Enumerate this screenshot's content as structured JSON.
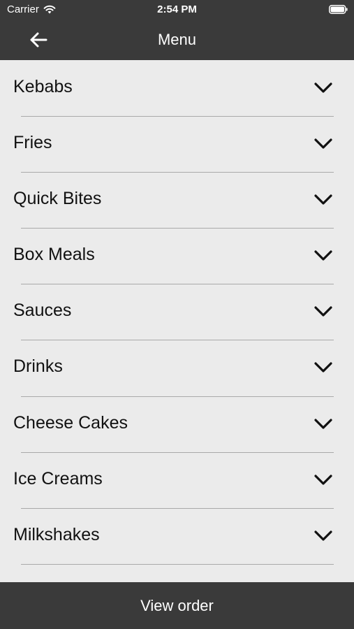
{
  "status_bar": {
    "carrier": "Carrier",
    "time": "2:54 PM"
  },
  "nav": {
    "title": "Menu",
    "back_icon": "arrow-left-icon"
  },
  "menu": {
    "categories": [
      {
        "label": "Kebabs"
      },
      {
        "label": "Fries"
      },
      {
        "label": "Quick Bites"
      },
      {
        "label": "Box Meals"
      },
      {
        "label": "Sauces"
      },
      {
        "label": "Drinks"
      },
      {
        "label": "Cheese Cakes"
      },
      {
        "label": "Ice Creams"
      },
      {
        "label": "Milkshakes"
      }
    ],
    "expand_icon": "chevron-down-icon"
  },
  "footer": {
    "button_label": "View order"
  },
  "colors": {
    "bar_background": "#3a3a3a",
    "list_background": "#ebebeb",
    "separator": "#a9a9a9"
  }
}
